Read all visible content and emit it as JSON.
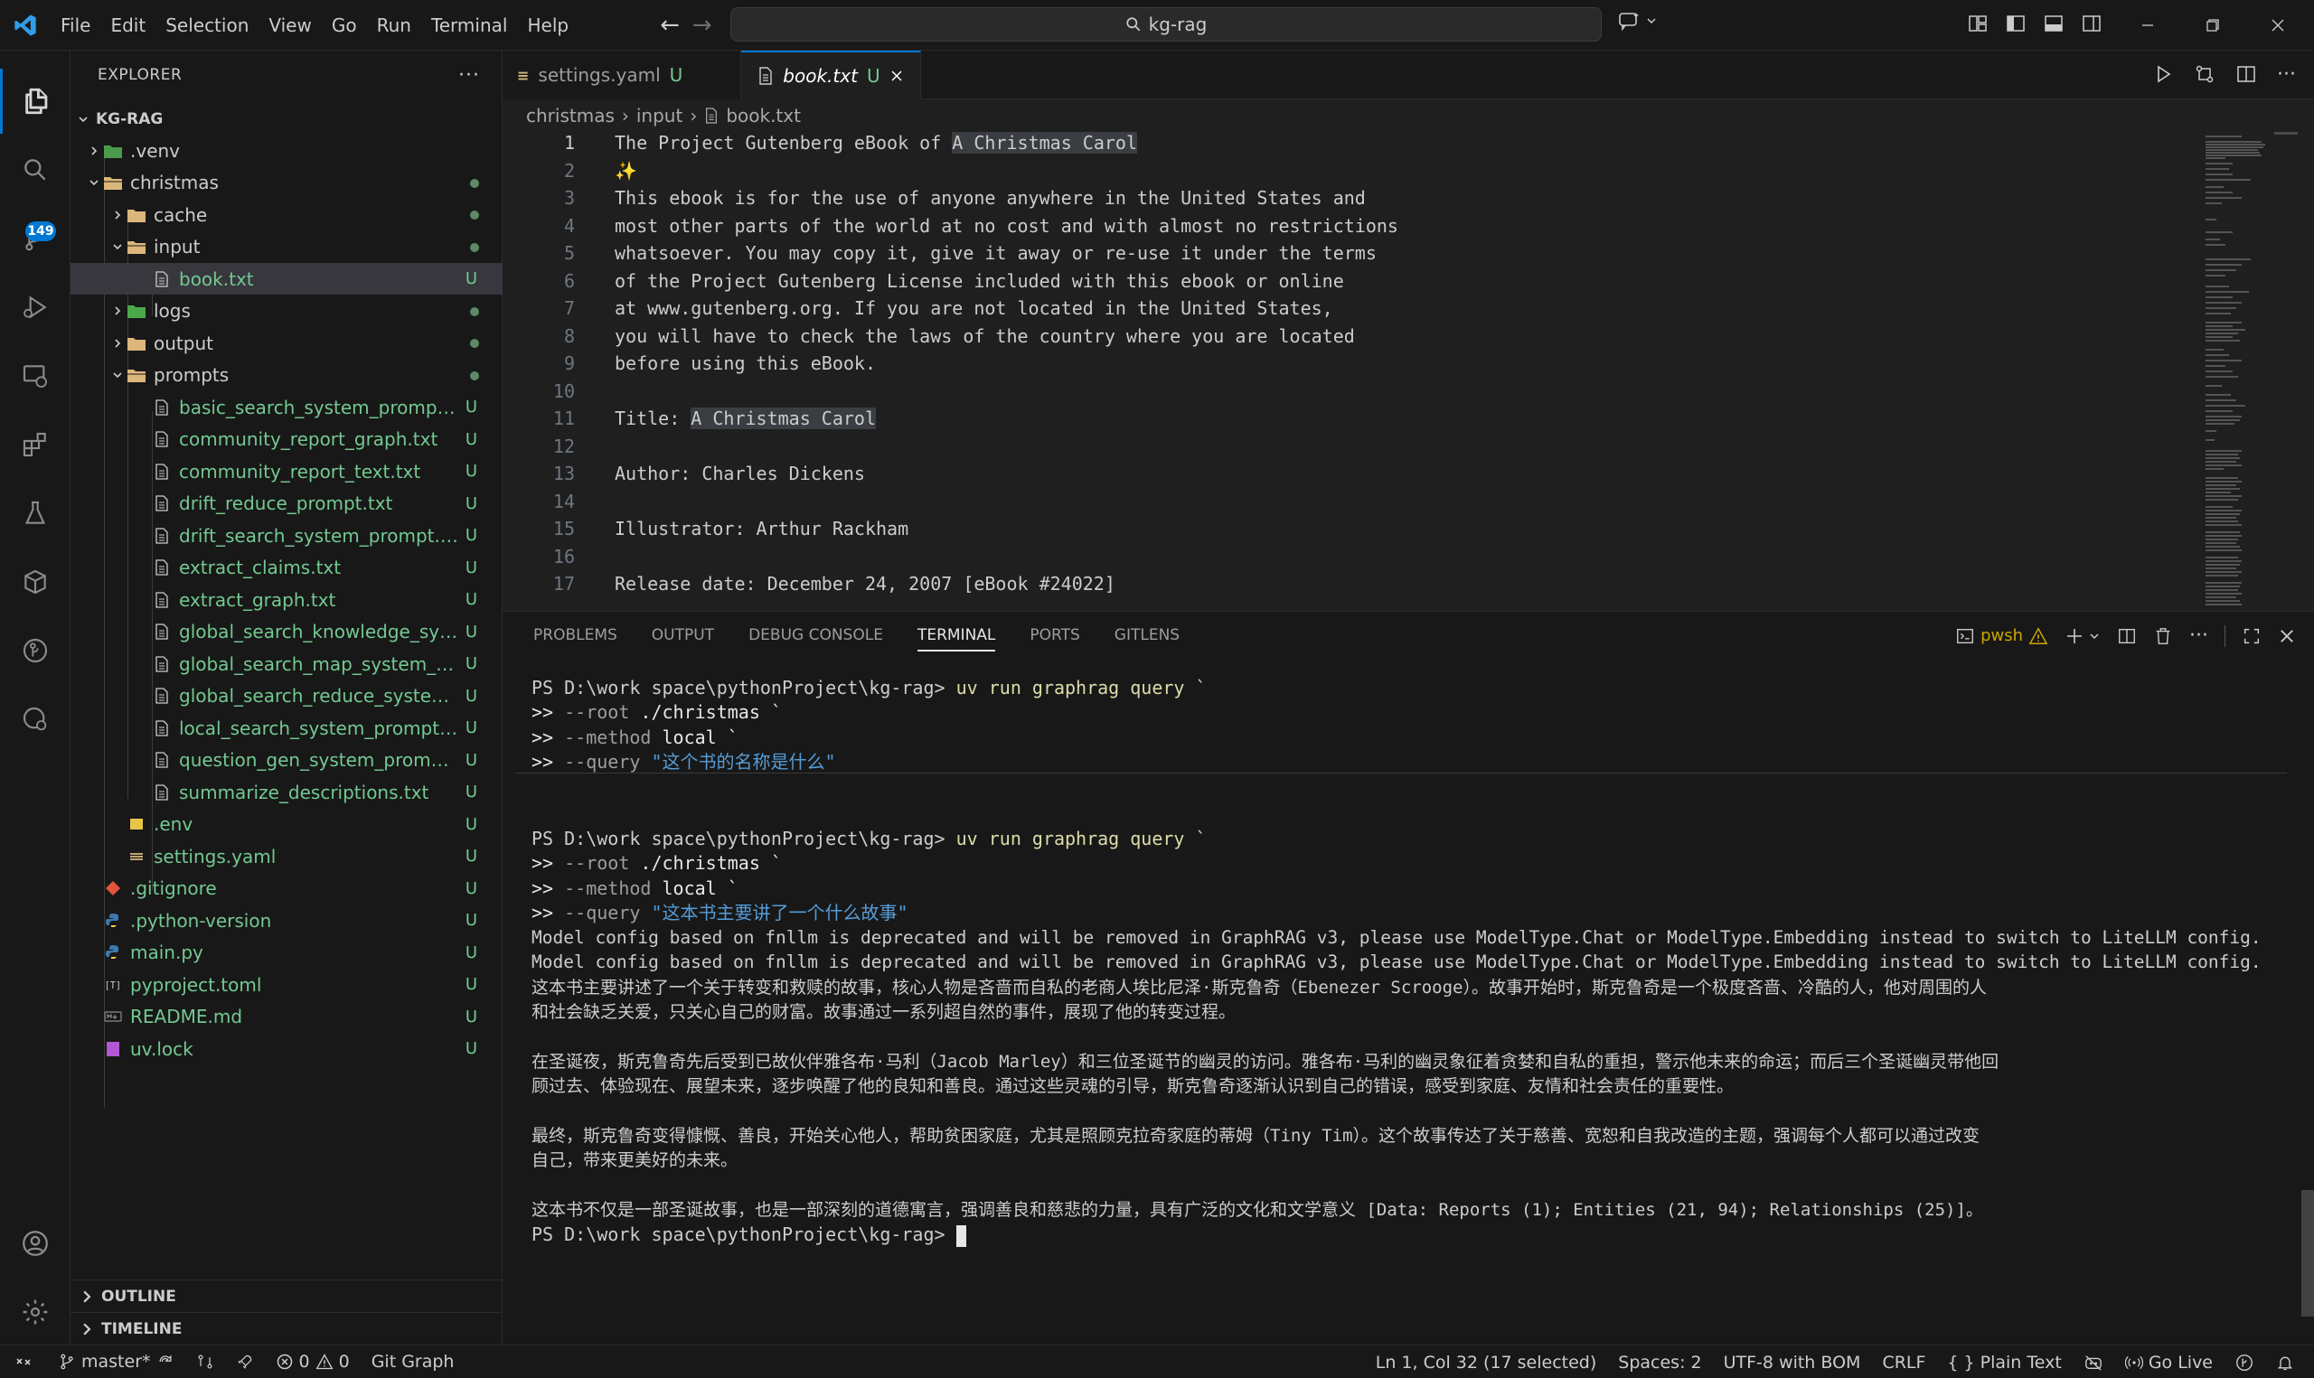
{
  "menu": [
    "File",
    "Edit",
    "Selection",
    "View",
    "Go",
    "Run",
    "Terminal",
    "Help"
  ],
  "search": {
    "text": "kg-rag"
  },
  "explorer": {
    "title": "EXPLORER",
    "root": "KG-RAG",
    "items": [
      {
        "name": ".venv",
        "status": ""
      },
      {
        "name": "christmas",
        "status": ""
      },
      {
        "name": "cache",
        "status": ""
      },
      {
        "name": "input",
        "status": ""
      },
      {
        "name": "book.txt",
        "status": "U"
      },
      {
        "name": "logs",
        "status": ""
      },
      {
        "name": "output",
        "status": ""
      },
      {
        "name": "prompts",
        "status": ""
      },
      {
        "name": "basic_search_system_prompt.txt",
        "status": "U"
      },
      {
        "name": "community_report_graph.txt",
        "status": "U"
      },
      {
        "name": "community_report_text.txt",
        "status": "U"
      },
      {
        "name": "drift_reduce_prompt.txt",
        "status": "U"
      },
      {
        "name": "drift_search_system_prompt.txt",
        "status": "U"
      },
      {
        "name": "extract_claims.txt",
        "status": "U"
      },
      {
        "name": "extract_graph.txt",
        "status": "U"
      },
      {
        "name": "global_search_knowledge_system_prompt.txt",
        "status": "U"
      },
      {
        "name": "global_search_map_system_prompt.txt",
        "status": "U"
      },
      {
        "name": "global_search_reduce_system_prompt.txt",
        "status": "U"
      },
      {
        "name": "local_search_system_prompt.txt",
        "status": "U"
      },
      {
        "name": "question_gen_system_prompt.txt",
        "status": "U"
      },
      {
        "name": "summarize_descriptions.txt",
        "status": "U"
      },
      {
        "name": ".env",
        "status": "U"
      },
      {
        "name": "settings.yaml",
        "status": "U"
      },
      {
        "name": ".gitignore",
        "status": "U"
      },
      {
        "name": ".python-version",
        "status": "U"
      },
      {
        "name": "main.py",
        "status": "U"
      },
      {
        "name": "pyproject.toml",
        "status": "U"
      },
      {
        "name": "README.md",
        "status": "U"
      },
      {
        "name": "uv.lock",
        "status": "U"
      }
    ],
    "outline": "OUTLINE",
    "timeline": "TIMELINE"
  },
  "scm_badge": "149",
  "tabs": [
    {
      "name": "settings.yaml",
      "status": "U"
    },
    {
      "name": "book.txt",
      "status": "U"
    }
  ],
  "breadcrumb": [
    "christmas",
    "input",
    "book.txt"
  ],
  "editor": {
    "lines": [
      {
        "n": "1",
        "pre": "The Project Gutenberg eBook of ",
        "hl": "A Christmas Carol",
        "post": ""
      },
      {
        "n": "2",
        "pre": "",
        "hl": "",
        "post": ""
      },
      {
        "n": "3",
        "pre": "This ebook is for the use of anyone anywhere in the United States and",
        "hl": "",
        "post": ""
      },
      {
        "n": "4",
        "pre": "most other parts of the world at no cost and with almost no restrictions",
        "hl": "",
        "post": ""
      },
      {
        "n": "5",
        "pre": "whatsoever. You may copy it, give it away or re-use it under the terms",
        "hl": "",
        "post": ""
      },
      {
        "n": "6",
        "pre": "of the Project Gutenberg License included with this ebook or online",
        "hl": "",
        "post": ""
      },
      {
        "n": "7",
        "pre": "at www.gutenberg.org. If you are not located in the United States,",
        "hl": "",
        "post": ""
      },
      {
        "n": "8",
        "pre": "you will have to check the laws of the country where you are located",
        "hl": "",
        "post": ""
      },
      {
        "n": "9",
        "pre": "before using this eBook.",
        "hl": "",
        "post": ""
      },
      {
        "n": "10",
        "pre": "",
        "hl": "",
        "post": ""
      },
      {
        "n": "11",
        "pre": "Title: ",
        "hl": "A Christmas Carol",
        "post": ""
      },
      {
        "n": "12",
        "pre": "",
        "hl": "",
        "post": ""
      },
      {
        "n": "13",
        "pre": "Author: Charles Dickens",
        "hl": "",
        "post": ""
      },
      {
        "n": "14",
        "pre": "",
        "hl": "",
        "post": ""
      },
      {
        "n": "15",
        "pre": "Illustrator: Arthur Rackham",
        "hl": "",
        "post": ""
      },
      {
        "n": "16",
        "pre": "",
        "hl": "",
        "post": ""
      },
      {
        "n": "17",
        "pre": "Release date: December 24, 2007 [eBook #24022]",
        "hl": "",
        "post": ""
      }
    ]
  },
  "panel": {
    "tabs": [
      "PROBLEMS",
      "OUTPUT",
      "DEBUG CONSOLE",
      "TERMINAL",
      "PORTS",
      "GITLENS"
    ],
    "shell": "pwsh"
  },
  "terminal": {
    "prompt1": "PS D:\\work space\\pythonProject\\kg-rag> ",
    "cmd": "uv run graphrag query `",
    "cont": ">> ",
    "root_flag": "--root ",
    "root_val": "./christmas `",
    "method_flag": "--method ",
    "method_val": "local `",
    "query_flag": "--query ",
    "q1": "\"这个书的名称是什么\"",
    "q2": "\"这本书主要讲了一个什么故事\"",
    "warn": "Model config based on fnllm is deprecated and will be removed in GraphRAG v3, please use ModelType.Chat or ModelType.Embedding instead to switch to LiteLLM config.",
    "p1a": "这本书主要讲述了一个关于转变和救赎的故事，核心人物是吝啬而自私的老商人埃比尼泽·斯克鲁奇（Ebenezer Scrooge）。故事开始时，斯克鲁奇是一个极度吝啬、冷酷的人，他对周围的人",
    "p1b": "和社会缺乏关爱，只关心自己的财富。故事通过一系列超自然的事件，展现了他的转变过程。",
    "p2a": "在圣诞夜，斯克鲁奇先后受到已故伙伴雅各布·马利（Jacob Marley）和三位圣诞节的幽灵的访问。雅各布·马利的幽灵象征着贪婪和自私的重担，警示他未来的命运；而后三个圣诞幽灵带他回",
    "p2b": "顾过去、体验现在、展望未来，逐步唤醒了他的良知和善良。通过这些灵魂的引导，斯克鲁奇逐渐认识到自己的错误，感受到家庭、友情和社会责任的重要性。",
    "p3a": "最终，斯克鲁奇变得慷慨、善良，开始关心他人，帮助贫困家庭，尤其是照顾克拉奇家庭的蒂姆（Tiny Tim）。这个故事传达了关于慈善、宽恕和自我改造的主题，强调每个人都可以通过改变",
    "p3b": "自己，带来更美好的未来。",
    "p4": "这本书不仅是一部圣诞故事，也是一部深刻的道德寓言，强调善良和慈悲的力量，具有广泛的文化和文学意义 [Data: Reports (1); Entities (21, 94); Relationships (25)]。"
  },
  "status": {
    "branch": "master*",
    "problems": "0",
    "warnings": "0",
    "git_graph": "Git Graph",
    "position": "Ln 1, Col 32 (17 selected)",
    "spaces": "Spaces: 2",
    "encoding": "UTF-8 with BOM",
    "eol": "CRLF",
    "language": "Plain Text",
    "golive": "Go Live"
  },
  "colors": {
    "accent": "#0078d4",
    "untracked": "#73c991",
    "bg": "#1f1f1f",
    "side": "#181818"
  }
}
